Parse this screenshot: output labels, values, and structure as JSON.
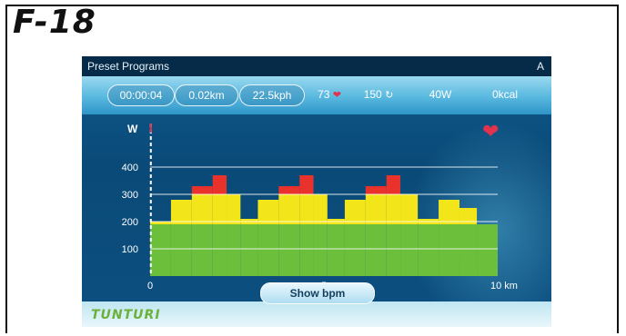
{
  "figure_label": "F-18",
  "header": {
    "title": "Preset Programs",
    "mode": "A"
  },
  "stats": {
    "time": "00:00:04",
    "distance": "0.02km",
    "speed": "22.5kph",
    "heart_rate": "73",
    "cadence": "150",
    "power": "40W",
    "energy": "0kcal"
  },
  "chart": {
    "ylabel": "W",
    "xlabel_unit": "km",
    "x_ticks": [
      "0",
      "5",
      "10 km"
    ],
    "y_ticks": [
      "100",
      "200",
      "300",
      "400"
    ]
  },
  "chart_data": {
    "type": "bar",
    "ylabel": "W",
    "ylim": [
      0,
      500
    ],
    "xlim": [
      0,
      10
    ],
    "segments": [
      {
        "from": 0.0,
        "to": 0.6,
        "value": 200
      },
      {
        "from": 0.6,
        "to": 1.2,
        "value": 280
      },
      {
        "from": 1.2,
        "to": 1.8,
        "value": 330
      },
      {
        "from": 1.8,
        "to": 2.2,
        "value": 370
      },
      {
        "from": 2.2,
        "to": 2.6,
        "value": 300
      },
      {
        "from": 2.6,
        "to": 3.1,
        "value": 210
      },
      {
        "from": 3.1,
        "to": 3.7,
        "value": 280
      },
      {
        "from": 3.7,
        "to": 4.3,
        "value": 330
      },
      {
        "from": 4.3,
        "to": 4.7,
        "value": 370
      },
      {
        "from": 4.7,
        "to": 5.1,
        "value": 300
      },
      {
        "from": 5.1,
        "to": 5.6,
        "value": 210
      },
      {
        "from": 5.6,
        "to": 6.2,
        "value": 280
      },
      {
        "from": 6.2,
        "to": 6.8,
        "value": 330
      },
      {
        "from": 6.8,
        "to": 7.2,
        "value": 370
      },
      {
        "from": 7.2,
        "to": 7.7,
        "value": 300
      },
      {
        "from": 7.7,
        "to": 8.3,
        "value": 210
      },
      {
        "from": 8.3,
        "to": 8.9,
        "value": 280
      },
      {
        "from": 8.9,
        "to": 9.4,
        "value": 250
      },
      {
        "from": 9.4,
        "to": 10.0,
        "value": 190
      }
    ],
    "grid_lines": [
      100,
      200,
      300,
      400
    ],
    "zones": {
      "green_max": 190,
      "yellow_max": 300
    },
    "colors": {
      "green": "#6cbf3b",
      "yellow": "#f2e51a",
      "red": "#e8322b",
      "grid": "#ffffff"
    },
    "progress_km": 0.02
  },
  "button": {
    "show_bpm": "Show bpm"
  },
  "brand": {
    "logo": "TUNTURI"
  }
}
